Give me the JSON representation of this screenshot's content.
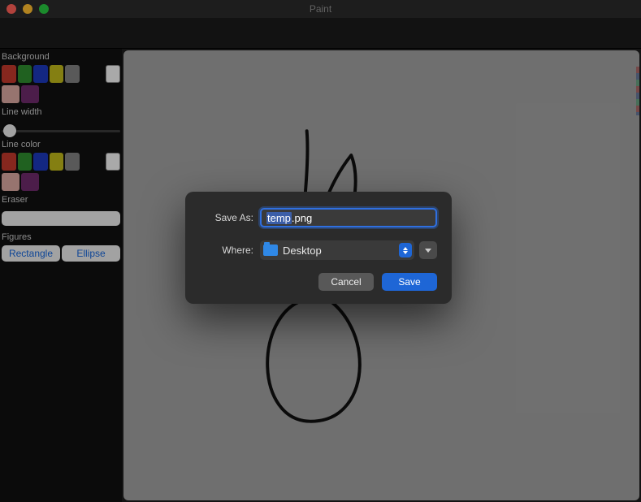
{
  "window": {
    "title": "Paint"
  },
  "sidebar": {
    "background_label": "Background",
    "line_width_label": "Line width",
    "line_color_label": "Line color",
    "eraser_label": "Eraser",
    "figures_label": "Figures",
    "rectangle_label": "Rectangle",
    "ellipse_label": "Ellipse"
  },
  "colors": {
    "swatches_row1": [
      "#c0392b",
      "#2e8b2e",
      "#1c39bb",
      "#bdb71a",
      "#808080"
    ],
    "swatches_row2": [
      "#d8a7a0",
      "#6e2a6b"
    ],
    "white": "#f2f2f2"
  },
  "save_dialog": {
    "saveas_label": "Save As:",
    "filename_selected": "temp",
    "filename_rest": ".png",
    "where_label": "Where:",
    "where_value": "Desktop",
    "cancel_label": "Cancel",
    "save_label": "Save"
  }
}
